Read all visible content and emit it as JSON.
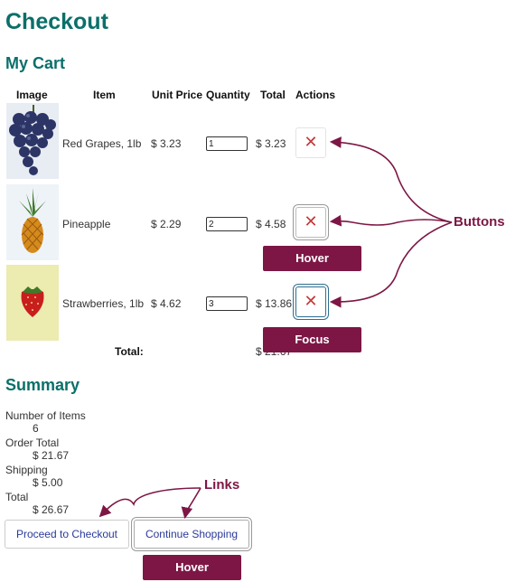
{
  "page": {
    "title": "Checkout"
  },
  "cart": {
    "title": "My Cart",
    "headers": [
      "Image",
      "Item",
      "Unit Price",
      "Quantity",
      "Total",
      "Actions"
    ],
    "rows": [
      {
        "item": "Red Grapes, 1lb",
        "unit_price": "$ 3.23",
        "quantity": "1",
        "total": "$ 3.23",
        "remove": "✕",
        "image": "red-grapes-image"
      },
      {
        "item": "Pineapple",
        "unit_price": "$ 2.29",
        "quantity": "2",
        "total": "$ 4.58",
        "remove": "✕",
        "image": "pineapple-image"
      },
      {
        "item": "Strawberries, 1lb",
        "unit_price": "$ 4.62",
        "quantity": "3",
        "total": "$ 13.86",
        "remove": "✕",
        "image": "strawberry-image"
      }
    ],
    "total_label": "Total:",
    "total_value": "$ 21.67"
  },
  "summary": {
    "title": "Summary",
    "number_of_items_label": "Number of Items",
    "number_of_items": "6",
    "order_total_label": "Order Total",
    "order_total": "$ 21.67",
    "shipping_label": "Shipping",
    "shipping": "$ 5.00",
    "total_label": "Total",
    "total": "$ 26.67"
  },
  "actions": {
    "proceed_label": "Proceed to Checkout",
    "continue_label": "Continue Shopping"
  },
  "annotations": {
    "buttons": "Buttons",
    "links": "Links",
    "hover": "Hover",
    "focus": "Focus",
    "color": "#7d1645"
  },
  "colors": {
    "heading": "#0b6f6a",
    "remove_icon": "#c23a3a",
    "link_text": "#2a3a9a"
  }
}
